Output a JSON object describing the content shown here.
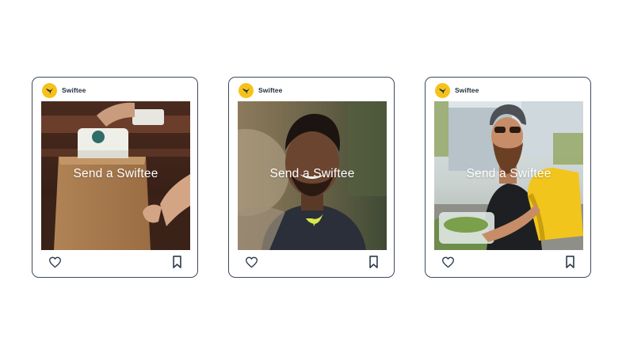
{
  "posts": [
    {
      "account": "Swiftee",
      "caption": "Send a Swiftee",
      "scene": "takeout-bag",
      "icons": {
        "avatar": "swiftee-bird-logo-icon",
        "like": "heart-icon",
        "save": "bookmark-icon"
      }
    },
    {
      "account": "Swiftee",
      "caption": "Send a Swiftee",
      "scene": "smiling-man",
      "icons": {
        "avatar": "swiftee-bird-logo-icon",
        "like": "heart-icon",
        "save": "bookmark-icon"
      }
    },
    {
      "account": "Swiftee",
      "caption": "Send a Swiftee",
      "scene": "delivery-cyclist",
      "icons": {
        "avatar": "swiftee-bird-logo-icon",
        "like": "heart-icon",
        "save": "bookmark-icon"
      }
    }
  ],
  "colors": {
    "brand": "#f6c21a",
    "border": "#3d4a5c",
    "icon": "#2d3a4c",
    "text": "#1f2d3d"
  }
}
